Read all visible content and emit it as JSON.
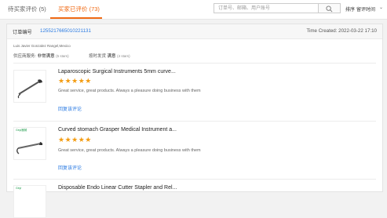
{
  "tabs": [
    {
      "label": "待买家评价 (5)"
    },
    {
      "label": "买家已评价 (73)"
    }
  ],
  "search": {
    "placeholder": "订单号、邮箱、用户账号"
  },
  "sort": {
    "label": "排序",
    "value": "留评时间"
  },
  "order": {
    "label": "订单编号",
    "number": "1255217665010221131",
    "time_created": "Time Created: 2022-03-22 17:10",
    "buyer": "Luis Javier Gonzalez Rangel,Mexico",
    "services": [
      {
        "label": "供应商服务:",
        "value": "非常满意",
        "stars": "(5 stars)"
      },
      {
        "label": "按时发货",
        "value": "满意",
        "stars": "(4 stars)"
      }
    ]
  },
  "items": [
    {
      "title": "Laparoscopic Surgical Instruments 5mm curve...",
      "rating": "★★★★★",
      "review": "Great service, great products. Always a pleasure doing business with them",
      "action": "回复该评论",
      "brand": ""
    },
    {
      "title": "Curved stomach Grasper Medical Instrument a...",
      "rating": "★★★★★",
      "review": "Great service, great products. Always a pleasure doing business with them",
      "action": "回复该评论",
      "brand": "Geyi器械"
    },
    {
      "title": "Disposable Endo Linear Cutter Stapler and Rel...",
      "rating": "",
      "review": "",
      "action": "",
      "brand": "Geyi"
    }
  ],
  "colors": {
    "accent": "#f06a14",
    "link": "#2a7ae2",
    "star": "#f39c12"
  }
}
